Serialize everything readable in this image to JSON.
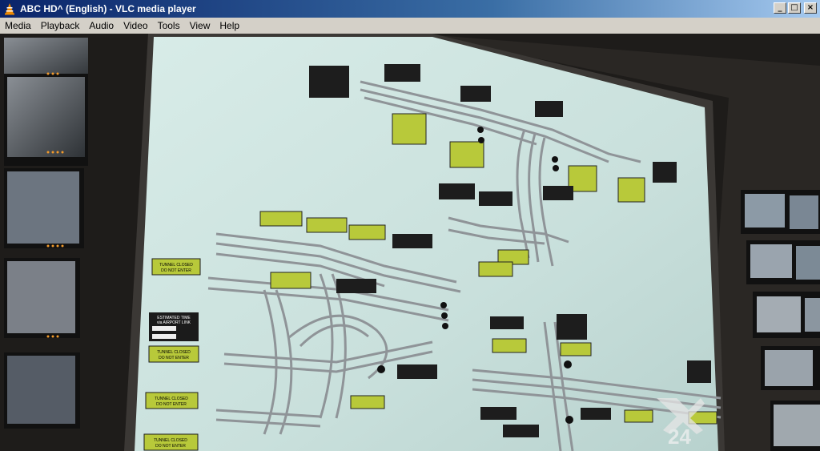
{
  "window": {
    "title": "ABC HD^ (English) - VLC media player",
    "controls": {
      "minimize": "_",
      "maximize": "□",
      "close": "×"
    }
  },
  "menu": [
    "Media",
    "Playback",
    "Audio",
    "Video",
    "Tools",
    "View",
    "Help"
  ],
  "colors": {
    "titlebar_start": "#0a246a",
    "titlebar_end": "#a6caf0",
    "vlc_orange": "#f08a00",
    "sign_green": "#b8c93a",
    "wall_bg": "#cfe3e0"
  },
  "video": {
    "signs": [
      "TUNNEL CLOSED",
      "DO NOT ENTER",
      "TUNNEL CLOSED",
      "DO NOT ENTER",
      "TUNNEL CLOSED",
      "DO NOT ENTER",
      "TUNNEL CLOSED",
      "DO NOT ENTER",
      "ESTIMATED TIME",
      "via AIRPORT LINK"
    ],
    "watermark": "24"
  }
}
